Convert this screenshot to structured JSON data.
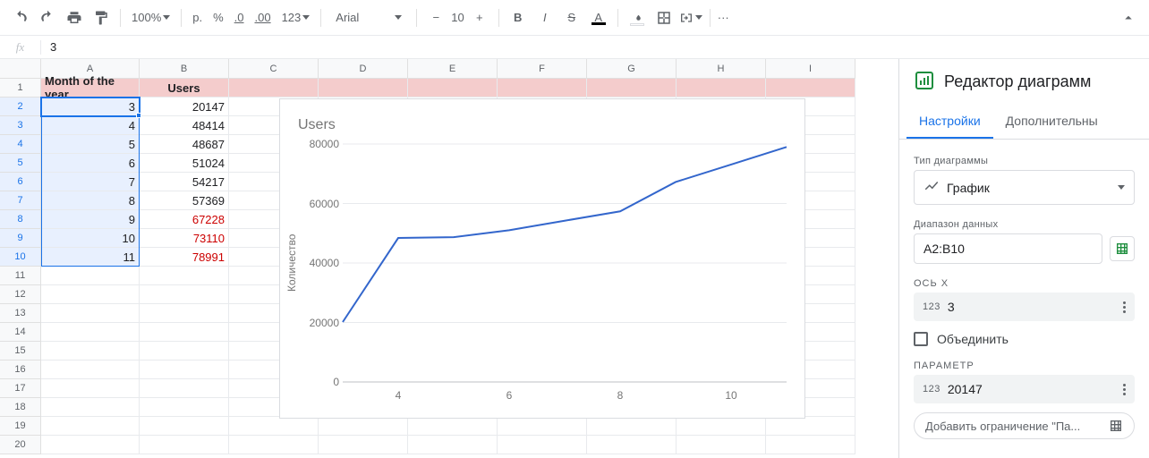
{
  "toolbar": {
    "zoom": "100%",
    "currency_label": "р.",
    "percent_label": "%",
    "dec_less": ".0",
    "dec_more": ".00",
    "numfmt": "123",
    "font": "Arial",
    "font_size": "10",
    "more": "···"
  },
  "fx": {
    "label": "fx",
    "value": "3"
  },
  "columns": [
    "A",
    "B",
    "C",
    "D",
    "E",
    "F",
    "G",
    "H",
    "I"
  ],
  "rows": [
    "1",
    "2",
    "3",
    "4",
    "5",
    "6",
    "7",
    "8",
    "9",
    "10",
    "11",
    "12",
    "13",
    "14",
    "15",
    "16",
    "17",
    "18",
    "19",
    "20"
  ],
  "header": {
    "a": "Month of the year",
    "b": "Users"
  },
  "data": [
    {
      "month": "3",
      "users": "20147",
      "red": false
    },
    {
      "month": "4",
      "users": "48414",
      "red": false
    },
    {
      "month": "5",
      "users": "48687",
      "red": false
    },
    {
      "month": "6",
      "users": "51024",
      "red": false
    },
    {
      "month": "7",
      "users": "54217",
      "red": false
    },
    {
      "month": "8",
      "users": "57369",
      "red": false
    },
    {
      "month": "9",
      "users": "67228",
      "red": true
    },
    {
      "month": "10",
      "users": "73110",
      "red": true
    },
    {
      "month": "11",
      "users": "78991",
      "red": true
    }
  ],
  "chart_data": {
    "type": "line",
    "title": "Users",
    "ylabel": "Количество",
    "xlabel": "",
    "x": [
      3,
      4,
      5,
      6,
      7,
      8,
      9,
      10,
      11
    ],
    "values": [
      20147,
      48414,
      48687,
      51024,
      54217,
      57369,
      67228,
      73110,
      78991
    ],
    "ylim": [
      0,
      80000
    ],
    "yticks": [
      0,
      20000,
      40000,
      60000,
      80000
    ],
    "xticks": [
      4,
      6,
      8,
      10
    ]
  },
  "panel": {
    "title": "Редактор диаграмм",
    "tabs": {
      "setup": "Настройки",
      "customize": "Дополнительны"
    },
    "chart_type_label": "Тип диаграммы",
    "chart_type_value": "График",
    "range_label": "Диапазон данных",
    "range_value": "A2:B10",
    "xaxis_label": "ОСЬ X",
    "xaxis_value": "3",
    "xaxis_prefix": "123",
    "combine_label": "Объединить",
    "series_label": "ПАРАМЕТР",
    "series_value": "20147",
    "series_prefix": "123",
    "add_param": "Добавить ограничение \"Па..."
  }
}
